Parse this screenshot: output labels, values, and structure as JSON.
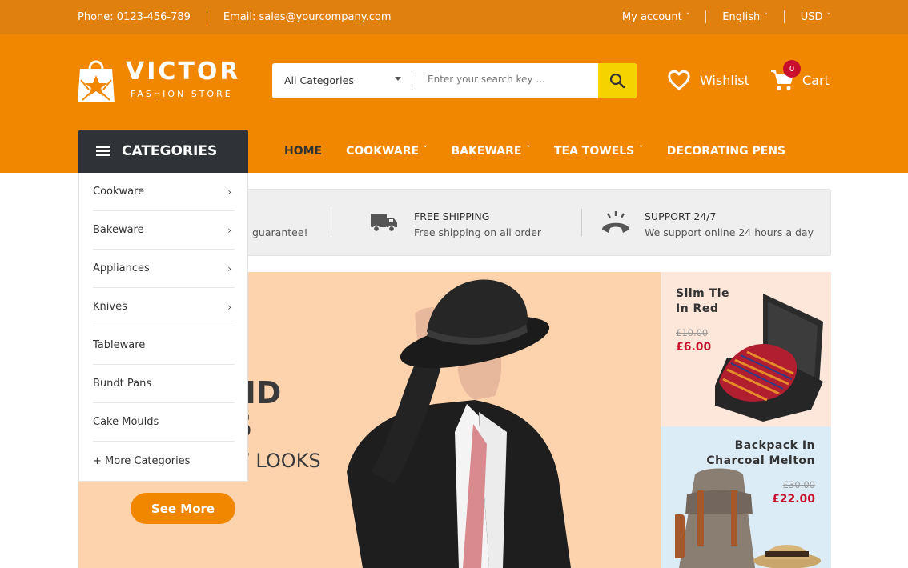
{
  "topbar": {
    "phone": "Phone: 0123-456-789",
    "email": "Email: sales@yourcompany.com",
    "account": "My account",
    "language": "English",
    "currency": "USD"
  },
  "brand": {
    "name": "VICTOR",
    "tagline": "FASHION STORE"
  },
  "search": {
    "category": "All Categories",
    "placeholder": "Enter your search key ..."
  },
  "wishlist": {
    "label": "Wishlist"
  },
  "cart": {
    "label": "Cart",
    "count": "0"
  },
  "categories": {
    "title": "CATEGORIES",
    "items": [
      {
        "label": "Cookware",
        "chevron": "›"
      },
      {
        "label": "Bakeware",
        "chevron": "›"
      },
      {
        "label": "Appliances",
        "chevron": "›"
      },
      {
        "label": "Knives",
        "chevron": "›"
      },
      {
        "label": "Tableware",
        "chevron": ""
      },
      {
        "label": "Bundt Pans",
        "chevron": ""
      },
      {
        "label": "Cake Moulds",
        "chevron": ""
      },
      {
        "label": "+ More Categories",
        "chevron": ""
      }
    ]
  },
  "nav": [
    {
      "label": "HOME",
      "caret": ""
    },
    {
      "label": "COOKWARE",
      "caret": "˅"
    },
    {
      "label": "BAKEWARE",
      "caret": "˅"
    },
    {
      "label": "TEA TOWELS",
      "caret": "˅"
    },
    {
      "label": "DECORATING PENS",
      "caret": ""
    }
  ],
  "features": {
    "partial_text": "guarantee!",
    "shipping": {
      "title": "FREE SHIPPING",
      "desc": "Free shipping on all order"
    },
    "support": {
      "title": "SUPPORT 24/7",
      "desc": "We support online 24 hours a day"
    }
  },
  "hero": {
    "line1": "ND",
    "line2": "S",
    "line3": "W LOOKS",
    "button": "See More"
  },
  "banners": [
    {
      "title_1": "Slim Tie",
      "title_2": "In Red",
      "old_price": "£10.00",
      "new_price": "£6.00"
    },
    {
      "title_1": "Backpack In",
      "title_2": "Charcoal Melton",
      "old_price": "£30.00",
      "new_price": "£22.00"
    }
  ],
  "colors": {
    "header_orange": "#f18700",
    "topbar_orange": "#e0800f",
    "search_button": "#f5d300",
    "price_red": "#c8102e",
    "dark": "#2f3337"
  },
  "icons": {
    "logo": "shopping-bag-icon",
    "search": "search-icon",
    "wishlist": "heart-icon",
    "cart": "cart-icon",
    "categories": "menu-icon",
    "shipping": "truck-icon",
    "support": "phone-icon"
  }
}
